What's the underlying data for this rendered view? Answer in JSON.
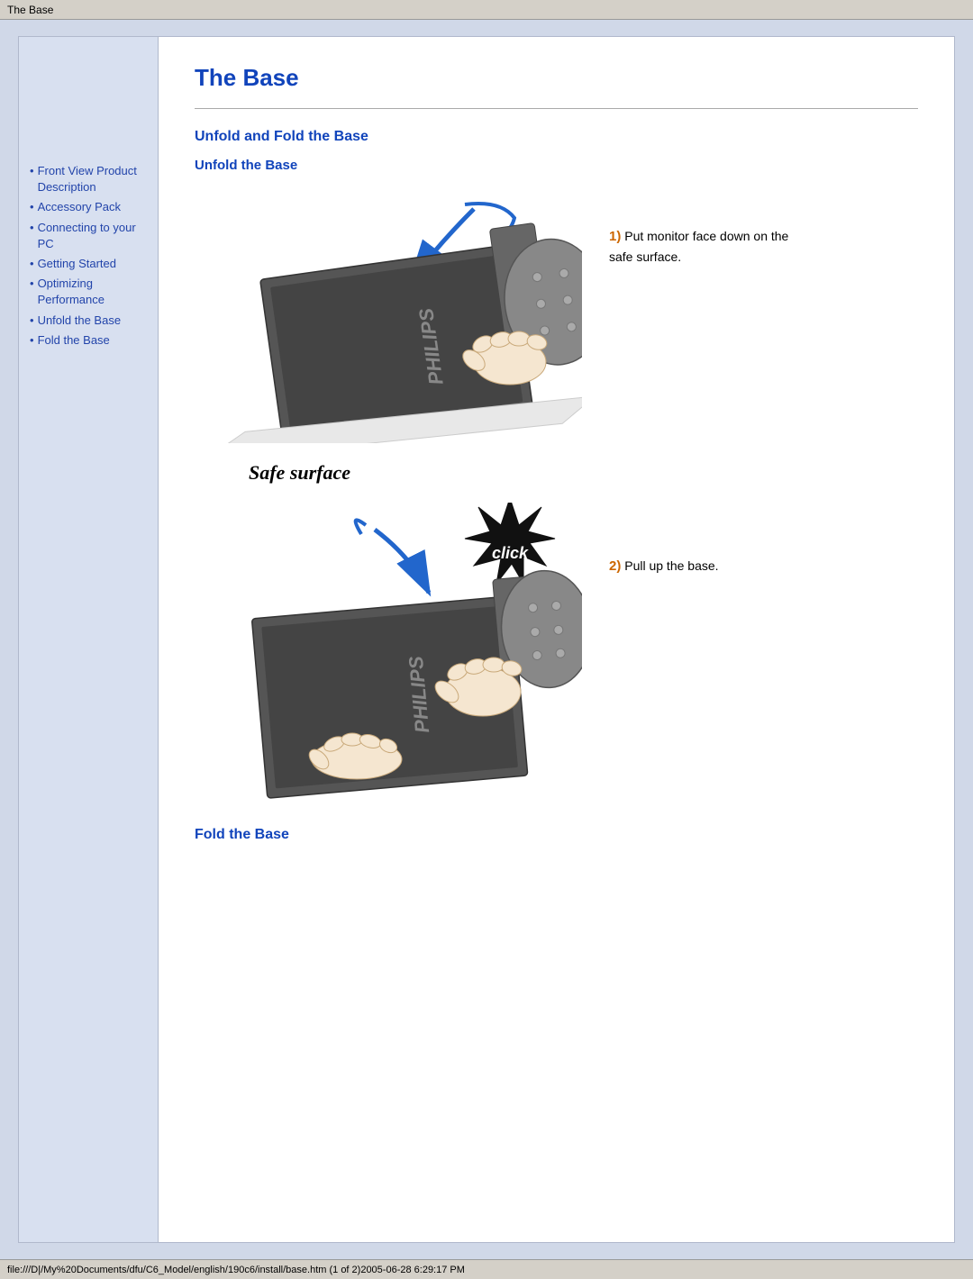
{
  "titlebar": {
    "text": "The Base"
  },
  "statusbar": {
    "text": "file:///D|/My%20Documents/dfu/C6_Model/english/190c6/install/base.htm (1 of 2)2005-06-28 6:29:17 PM"
  },
  "sidebar": {
    "items": [
      {
        "label": "Front View Product Description",
        "id": "front-view"
      },
      {
        "label": "Accessory Pack",
        "id": "accessory"
      },
      {
        "label": "Connecting to your PC",
        "id": "connecting"
      },
      {
        "label": "Getting Started",
        "id": "getting-started"
      },
      {
        "label": "Optimizing Performance",
        "id": "performance"
      },
      {
        "label": "Unfold the Base",
        "id": "unfold"
      },
      {
        "label": "Fold the Base",
        "id": "fold"
      }
    ]
  },
  "content": {
    "page_title": "The Base",
    "section_heading": "Unfold and Fold the Base",
    "sub_heading": "Unfold the Base",
    "step1_number": "1)",
    "step1_text": "Put monitor face down on the safe surface.",
    "safe_surface_label": "Safe surface",
    "step2_number": "2)",
    "step2_text": "Pull up the base.",
    "fold_heading": "Fold the Base"
  },
  "colors": {
    "blue_heading": "#1144bb",
    "orange": "#cc6600",
    "sidebar_bg": "#d8e0f0"
  }
}
